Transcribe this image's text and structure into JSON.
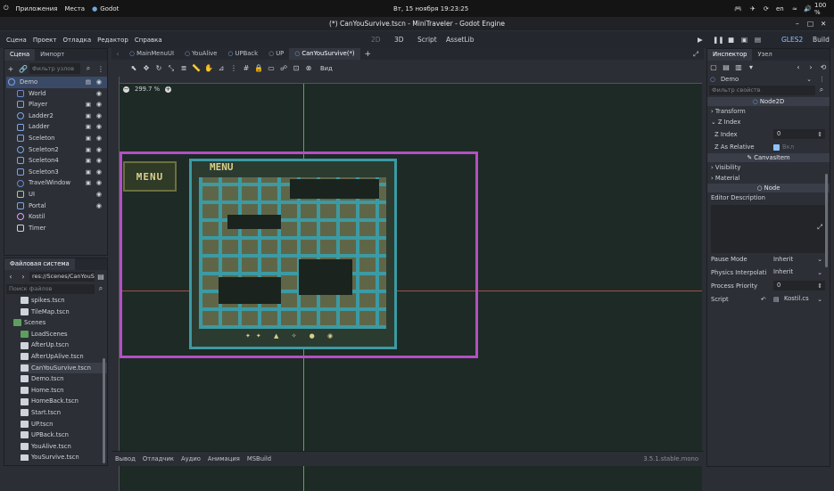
{
  "system_bar": {
    "apps": "Приложения",
    "places": "Места",
    "app": "Godot",
    "datetime": "Вт, 15 ноября 19:23:25",
    "lang": "en",
    "battery": "100 %"
  },
  "window_title": "(*) CanYouSurvive.tscn - MiniTraveler - Godot Engine",
  "menu": {
    "scene": "Сцена",
    "project": "Проект",
    "debug": "Отладка",
    "editor": "Редактор",
    "help": "Справка"
  },
  "workspaces": {
    "w2d": "2D",
    "w3d": "3D",
    "script": "Script",
    "assetlib": "AssetLib"
  },
  "renderer": "GLES2",
  "build": "Build",
  "scene_panel": {
    "tab_scene": "Сцена",
    "tab_import": "Импорт",
    "filter_placeholder": "Фильтр узлов",
    "nodes": [
      {
        "name": "Demo",
        "color": "#7da6e8"
      },
      {
        "name": "World",
        "color": "#6a88d4"
      },
      {
        "name": "Player",
        "color": "#7da6e8"
      },
      {
        "name": "Ladder2",
        "color": "#7da6e8"
      },
      {
        "name": "Ladder",
        "color": "#7da6e8"
      },
      {
        "name": "Sceleton",
        "color": "#7da6e8"
      },
      {
        "name": "Sceleton2",
        "color": "#7da6e8"
      },
      {
        "name": "Sceleton4",
        "color": "#7da6e8"
      },
      {
        "name": "Sceleton3",
        "color": "#7da6e8"
      },
      {
        "name": "TravelWindow",
        "color": "#6a88d4"
      },
      {
        "name": "UI",
        "color": "#8edc8e"
      },
      {
        "name": "Portal",
        "color": "#7da6e8"
      },
      {
        "name": "Kostil",
        "color": "#e0a0ff"
      },
      {
        "name": "Timer",
        "color": "#cfd3da"
      }
    ]
  },
  "filesystem": {
    "title": "Файловая система",
    "path": "res://Scenes/CanYouS",
    "search_placeholder": "Поиск файлов",
    "files": [
      {
        "name": "spikes.tscn",
        "folder": false
      },
      {
        "name": "TileMap.tscn",
        "folder": false
      },
      {
        "name": "Scenes",
        "folder": true
      },
      {
        "name": "LoadScenes",
        "folder": true
      },
      {
        "name": "AfterUp.tscn",
        "folder": false
      },
      {
        "name": "AfterUpAlive.tscn",
        "folder": false
      },
      {
        "name": "CanYouSurvive.tscn",
        "folder": false
      },
      {
        "name": "Demo.tscn",
        "folder": false
      },
      {
        "name": "Home.tscn",
        "folder": false
      },
      {
        "name": "HomeBack.tscn",
        "folder": false
      },
      {
        "name": "Start.tscn",
        "folder": false
      },
      {
        "name": "UP.tscn",
        "folder": false
      },
      {
        "name": "UPBack.tscn",
        "folder": false
      },
      {
        "name": "YouAlive.tscn",
        "folder": false
      },
      {
        "name": "YouSurvive.tscn",
        "folder": false
      }
    ]
  },
  "editor_tabs": [
    "MainMenuUI",
    "YouAlive",
    "UPBack",
    "UP",
    "CanYouSurvive(*)"
  ],
  "view_label": "Вид",
  "zoom": "299.7 %",
  "bottom_tabs": [
    "Вывод",
    "Отладчик",
    "Аудио",
    "Анимация",
    "MSBuild"
  ],
  "version": "3.5.1.stable.mono",
  "inspector": {
    "tab_inspector": "Инспектор",
    "tab_node": "Узел",
    "node_name": "Demo",
    "filter_placeholder": "Фильтр свойств",
    "class_node2d": "Node2D",
    "transform": "Transform",
    "z_index_section": "Z Index",
    "z_index_label": "Z Index",
    "z_index_value": "0",
    "z_relative_label": "Z As Relative",
    "z_relative_value": "Вкл",
    "class_canvasitem": "CanvasItem",
    "visibility": "Visibility",
    "material": "Material",
    "class_node": "Node",
    "editor_description": "Editor Description",
    "pause_mode_label": "Pause Mode",
    "pause_mode_value": "Inherit",
    "physics_label": "Physics Interpolati",
    "physics_value": "Inherit",
    "priority_label": "Process Priority",
    "priority_value": "0",
    "script_label": "Script",
    "script_value": "Kostil.cs"
  },
  "game_preview": {
    "menu_button": "MENU",
    "menu_title": "MENU"
  }
}
